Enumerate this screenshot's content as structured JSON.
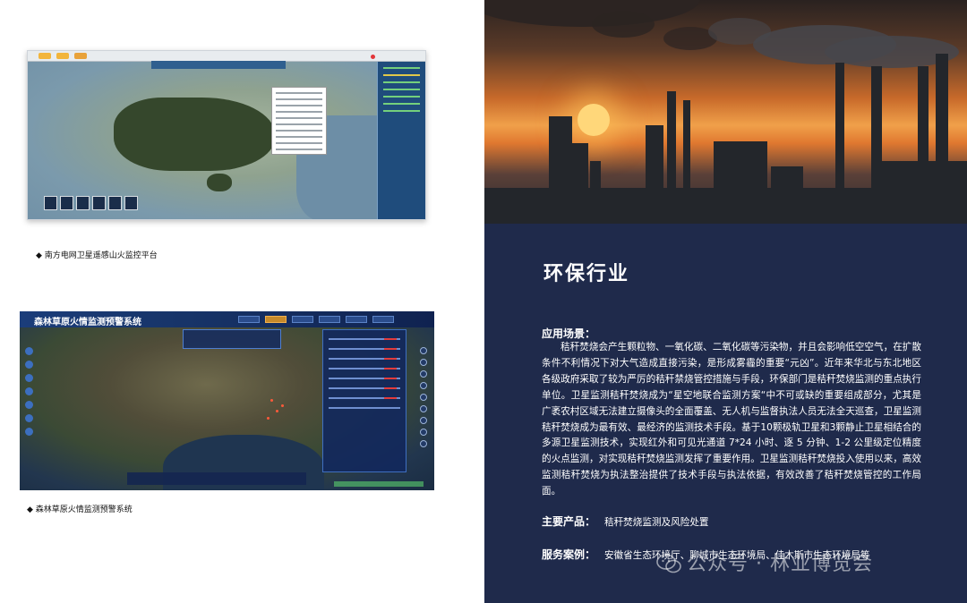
{
  "left_page": {
    "screenshot1": {
      "caption": "◆ 南方电网卫星遥感山火监控平台"
    },
    "screenshot2": {
      "title": "森林草原火情监测预警系统",
      "caption": "◆ 森林草原火情监测预警系统"
    }
  },
  "right_page": {
    "section_title": "环保行业",
    "application": {
      "label": "应用场景：",
      "text": "秸秆焚烧会产生颗粒物、一氧化碳、二氧化碳等污染物，并且会影响低空空气，在扩散条件不利情况下对大气造成直接污染，是形成雾霾的重要“元凶”。近年来华北与东北地区各级政府采取了较为严厉的秸秆禁烧管控措施与手段，环保部门是秸秆焚烧监测的重点执行单位。卫星监测秸秆焚烧成为“星空地联合监测方案“中不可或缺的重要组成部分，尤其是广袤农村区域无法建立摄像头的全面覆盖、无人机与监督执法人员无法全天巡查，卫星监测秸秆焚烧成为最有效、最经济的监测技术手段。基于10颗极轨卫星和3颗静止卫星相结合的多源卫星监测技术，实现红外和可见光通道 7*24 小时、逐 5 分钟、1-2 公里级定位精度的火点监测，对实现秸秆焚烧监测发挥了重要作用。卫星监测秸秆焚烧投入使用以来，高效监测秸秆焚烧为执法整治提供了技术手段与执法依据，有效改善了秸秆焚烧管控的工作局面。"
    },
    "products": {
      "label": "主要产品：",
      "value": "秸秆焚烧监测及风险处置"
    },
    "cases": {
      "label": "服务案例：",
      "value": "安徽省生态环境厅、聊城市生态环境局、佳木斯市生态环境局等"
    },
    "watermark": "公众号 · 林业博览会"
  },
  "colors": {
    "right_bg": "#1f2a4b",
    "text": "#ffffff"
  }
}
